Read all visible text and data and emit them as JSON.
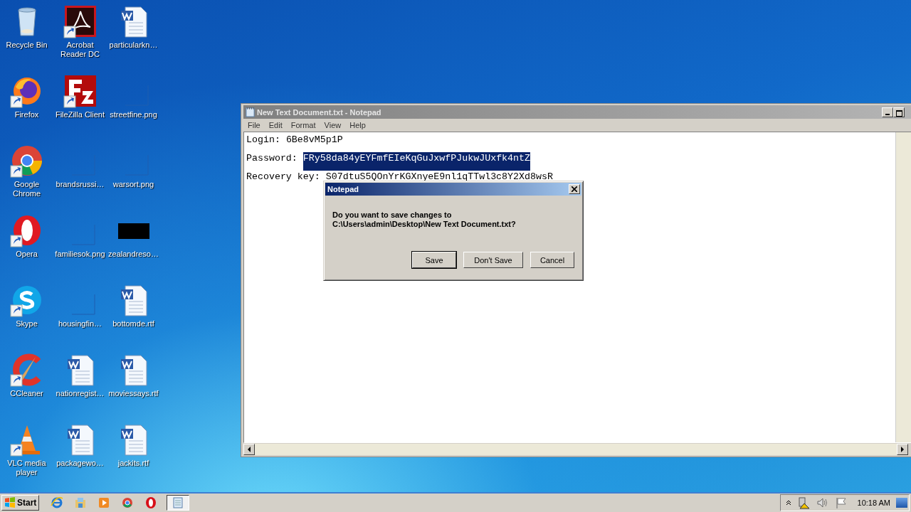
{
  "desktop": {
    "icons": [
      {
        "label": "Recycle Bin",
        "kind": "recycle",
        "shortcut": false
      },
      {
        "label": "Firefox",
        "kind": "firefox",
        "shortcut": true
      },
      {
        "label": "Google Chrome",
        "kind": "chrome",
        "shortcut": true
      },
      {
        "label": "Opera",
        "kind": "opera",
        "shortcut": true
      },
      {
        "label": "Skype",
        "kind": "skype",
        "shortcut": true
      },
      {
        "label": "CCleaner",
        "kind": "ccleaner",
        "shortcut": true
      },
      {
        "label": "VLC media player",
        "kind": "vlc",
        "shortcut": true
      },
      {
        "label": "Acrobat Reader DC",
        "kind": "acrobat",
        "shortcut": true
      },
      {
        "label": "FileZilla Client",
        "kind": "filezilla",
        "shortcut": true
      },
      {
        "label": "brandsrussi…",
        "kind": "blank",
        "shortcut": false
      },
      {
        "label": "familiesok.png",
        "kind": "blank",
        "shortcut": false
      },
      {
        "label": "housingfin…",
        "kind": "blank",
        "shortcut": false
      },
      {
        "label": "nationregist…",
        "kind": "word",
        "shortcut": false
      },
      {
        "label": "packagewo…",
        "kind": "word",
        "shortcut": false
      },
      {
        "label": "particularkn…",
        "kind": "word",
        "shortcut": false
      },
      {
        "label": "streetfine.png",
        "kind": "blank",
        "shortcut": false
      },
      {
        "label": "warsort.png",
        "kind": "blank",
        "shortcut": false
      },
      {
        "label": "zealandreso…",
        "kind": "black",
        "shortcut": false
      },
      {
        "label": "bottomde.rtf",
        "kind": "word",
        "shortcut": false
      },
      {
        "label": "moviessays.rtf",
        "kind": "word",
        "shortcut": false
      },
      {
        "label": "jackits.rtf",
        "kind": "word",
        "shortcut": false
      }
    ]
  },
  "notepad": {
    "title": "New Text Document.txt - Notepad",
    "menu": [
      "File",
      "Edit",
      "Format",
      "View",
      "Help"
    ],
    "lines": [
      {
        "label": "Login:",
        "value": "6Be8vM5p1P",
        "selected": false
      },
      {
        "label": "Password:",
        "value": "FRy58da84yEYFmfEIeKqGuJxwfPJukwJUxfk4ntZ",
        "selected": true
      },
      {
        "label": "Recovery key:",
        "value": "S07dtuS5QOnYrKGXnyeE9nl1qTTwl3c8Y2Xd8wsR",
        "selected": false
      }
    ]
  },
  "dialog": {
    "title": "Notepad",
    "message": [
      "Do you want to save changes to",
      "C:\\Users\\admin\\Desktop\\New Text Document.txt?"
    ],
    "buttons": [
      {
        "label": "Save",
        "default": true
      },
      {
        "label": "Don't Save",
        "default": false
      },
      {
        "label": "Cancel",
        "default": false
      }
    ]
  },
  "taskbar": {
    "start": "Start",
    "apps": [
      {
        "kind": "ie",
        "selected": false
      },
      {
        "kind": "explorer",
        "selected": false
      },
      {
        "kind": "media",
        "selected": false
      },
      {
        "kind": "chrome",
        "selected": false
      },
      {
        "kind": "opera",
        "selected": false
      },
      {
        "kind": "notepad",
        "selected": true
      }
    ],
    "clock": "10:18 AM"
  }
}
